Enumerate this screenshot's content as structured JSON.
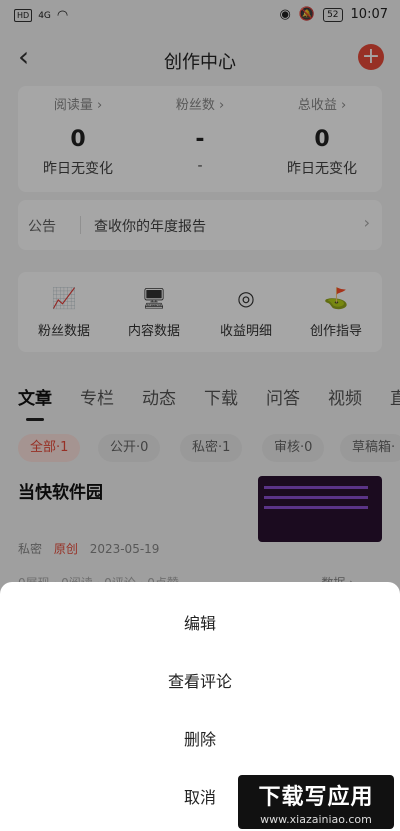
{
  "status_bar": {
    "hd": "HD",
    "signal": "4G",
    "battery": "52",
    "time": "10:07"
  },
  "nav": {
    "title": "创作中心",
    "back_icon": "chevron-left-icon",
    "add_icon": "plus-circle-icon"
  },
  "stats": [
    {
      "label": "阅读量 ›",
      "value": "0",
      "sub": "昨日无变化"
    },
    {
      "label": "粉丝数 ›",
      "value": "-",
      "sub": "-"
    },
    {
      "label": "总收益 ›",
      "value": "0",
      "sub": "昨日无变化"
    }
  ],
  "notice": {
    "tag": "公告",
    "text": "查收你的年度报告",
    "arrow": "›"
  },
  "tools": [
    {
      "label": "粉丝数据",
      "icon": "fan-data-icon",
      "glyph": "📈"
    },
    {
      "label": "内容数据",
      "icon": "content-data-icon",
      "glyph": "🖥"
    },
    {
      "label": "收益明细",
      "icon": "earnings-icon",
      "glyph": "◎"
    },
    {
      "label": "创作指导",
      "icon": "guide-icon",
      "glyph": "⛳"
    }
  ],
  "tabs": [
    "文章",
    "专栏",
    "动态",
    "下载",
    "问答",
    "视频",
    "直"
  ],
  "filters": [
    "全部·1",
    "公开·0",
    "私密·1",
    "审核·0",
    "草稿箱·"
  ],
  "article": {
    "title": "当快软件园",
    "privacy": "私密",
    "original": "原创",
    "date": "2023-05-19",
    "stats": "0展现 · 0阅读 · 0评论 · 0点赞",
    "data_link": "数据 ›"
  },
  "sheet": {
    "edit": "编辑",
    "view_comments": "查看评论",
    "delete": "删除",
    "cancel": "取消"
  },
  "watermark": {
    "main": "下载写应用",
    "sub": "www.xiazainiao.com"
  },
  "colors": {
    "accent": "#e84b3a",
    "overlay": "rgba(0,0,0,0.35)"
  }
}
